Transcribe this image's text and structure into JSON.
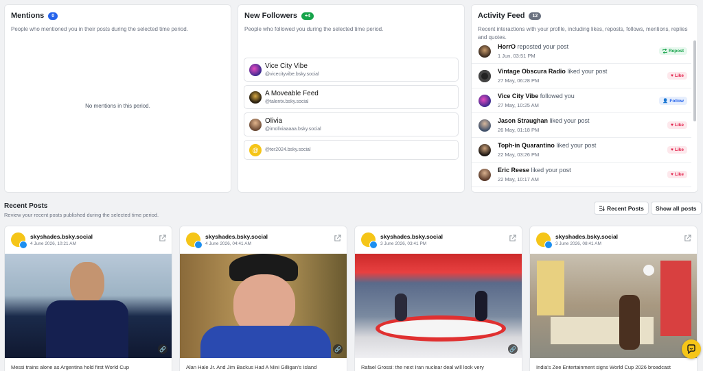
{
  "mentions": {
    "title": "Mentions",
    "count": "0",
    "subtitle": "People who mentioned you in their posts during the selected time period.",
    "empty_text": "No mentions in this period."
  },
  "followers": {
    "title": "New Followers",
    "count": "+4",
    "subtitle": "People who followed you during the selected time period.",
    "items": [
      {
        "name": "Vice City Vibe",
        "handle": "@vicecityvibe.bsky.social"
      },
      {
        "name": "A Moveable Feed",
        "handle": "@talentx.bsky.social"
      },
      {
        "name": "Olivia",
        "handle": "@imoliviaaaaa.bsky.social"
      },
      {
        "name": "",
        "handle": "@ter2024.bsky.social"
      }
    ]
  },
  "activity": {
    "title": "Activity Feed",
    "count": "12",
    "subtitle": "Recent interactions with your profile, including likes, reposts, follows, mentions, replies and quotes.",
    "items": [
      {
        "name": "HorrO",
        "action": "reposted your post",
        "date": "1 Jun, 03:51 PM",
        "tag": "Repost"
      },
      {
        "name": "Vintage Obscura Radio",
        "action": "liked your post",
        "date": "27 May, 06:28 PM",
        "tag": "Like"
      },
      {
        "name": "Vice City Vibe",
        "action": "followed you",
        "date": "27 May, 10:25 AM",
        "tag": "Follow"
      },
      {
        "name": "Jason Straughan",
        "action": "liked your post",
        "date": "26 May, 01:18 PM",
        "tag": "Like"
      },
      {
        "name": "Toph-in Quarantino",
        "action": "liked your post",
        "date": "22 May, 03:26 PM",
        "tag": "Like"
      },
      {
        "name": "Eric Reese",
        "action": "liked your post",
        "date": "22 May, 10:17 AM",
        "tag": "Like"
      }
    ]
  },
  "recent_posts": {
    "title": "Recent Posts",
    "subtitle": "Review your recent posts published during the selected time period.",
    "recent_button": "Recent Posts",
    "show_all_button": "Show all posts",
    "posts": [
      {
        "handle": "skyshades.bsky.social",
        "date": "4 June 2026, 10:21 AM",
        "caption": "Messi trains alone as Argentina hold first World Cup"
      },
      {
        "handle": "skyshades.bsky.social",
        "date": "4 June 2026, 04:41 AM",
        "caption": "Alan Hale Jr. And Jim Backus Had A Mini Gilligan's Island"
      },
      {
        "handle": "skyshades.bsky.social",
        "date": "3 June 2026, 03:41 PM",
        "caption": "Rafael Grossi: the next Iran nuclear deal will look very"
      },
      {
        "handle": "skyshades.bsky.social",
        "date": "3 June 2026, 08:41 AM",
        "caption": "India's Zee Entertainment signs World Cup 2026 broadcast"
      }
    ]
  },
  "colors": {
    "mentions_badge": "#2563eb",
    "followers_badge": "#16a34a",
    "activity_badge": "#6b7280",
    "accent_yellow": "#f5c518"
  }
}
